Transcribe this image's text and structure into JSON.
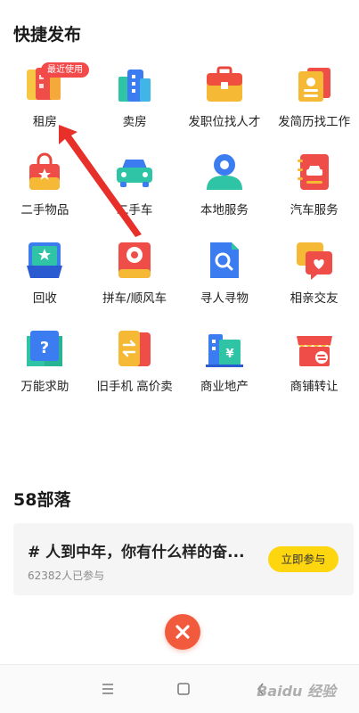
{
  "quick_publish": {
    "title": "快捷发布",
    "recent_badge": "最近使用",
    "items": [
      {
        "label": "租房",
        "icon": "house-rent-icon"
      },
      {
        "label": "卖房",
        "icon": "house-sale-icon"
      },
      {
        "label": "发职位找人才",
        "icon": "briefcase-icon"
      },
      {
        "label": "发简历找工作",
        "icon": "resume-icon"
      },
      {
        "label": "二手物品",
        "icon": "shopping-bag-icon"
      },
      {
        "label": "二手车",
        "icon": "car-icon"
      },
      {
        "label": "本地服务",
        "icon": "local-service-icon"
      },
      {
        "label": "汽车服务",
        "icon": "car-service-icon"
      },
      {
        "label": "回收",
        "icon": "recycle-box-icon"
      },
      {
        "label": "拼车/顺风车",
        "icon": "carpool-icon"
      },
      {
        "label": "寻人寻物",
        "icon": "search-document-icon"
      },
      {
        "label": "相亲交友",
        "icon": "dating-heart-icon"
      },
      {
        "label": "万能求助",
        "icon": "help-book-icon"
      },
      {
        "label": "旧手机 高价卖",
        "icon": "phone-trade-icon"
      },
      {
        "label": "商业地产",
        "icon": "commercial-building-icon"
      },
      {
        "label": "商铺转让",
        "icon": "shop-transfer-icon"
      }
    ]
  },
  "tribe": {
    "title": "58部落",
    "topic": "# 人到中年，你有什么样的奋...",
    "count": "62382人已参与",
    "join_label": "立即参与"
  },
  "watermark": "Baidu 经验",
  "colors": {
    "accent_yellow": "#fdd60f",
    "close_red": "#f15a3c",
    "badge_red": "#f2494a",
    "arrow_red": "#e8302a"
  }
}
